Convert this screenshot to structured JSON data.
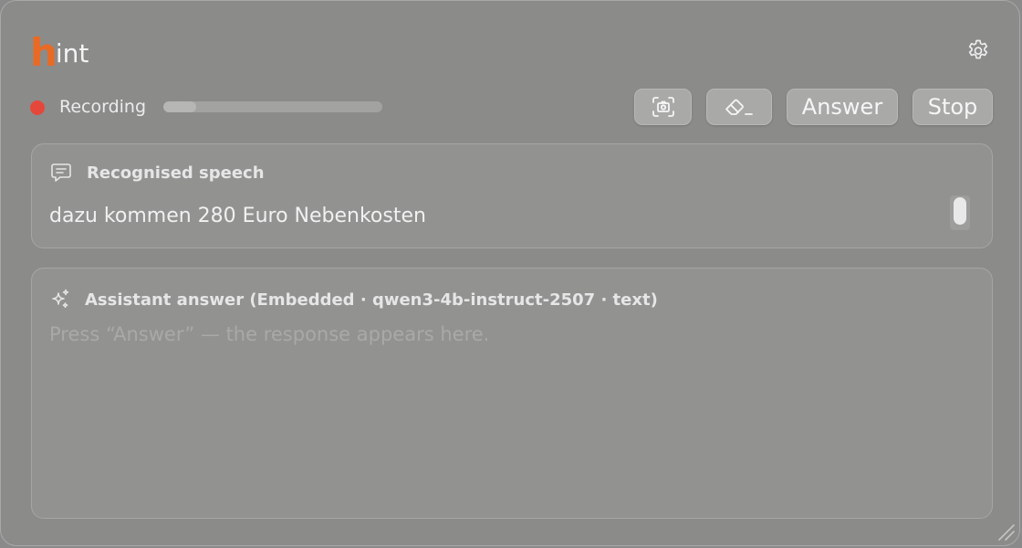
{
  "app": {
    "logo_initial": "h",
    "logo_rest": "int"
  },
  "recording": {
    "status_label": "Recording",
    "level": 0.15,
    "dot_color": "#e5483b"
  },
  "toolbar": {
    "screenshot_icon": "screenshot-camera-icon",
    "clear_icon": "eraser-icon",
    "answer_label": "Answer",
    "stop_label": "Stop"
  },
  "speech_panel": {
    "title": "Recognised speech",
    "icon": "speech-bubble-icon",
    "text": "dazu kommen 280 Euro Nebenkosten"
  },
  "answer_panel": {
    "title": "Assistant answer (Embedded · qwen3-4b-instruct-2507 · text)",
    "icon": "sparkles-icon",
    "placeholder": "Press “Answer” — the response appears here."
  },
  "colors": {
    "accent": "#e96a24",
    "background": "#8b8b8a"
  }
}
